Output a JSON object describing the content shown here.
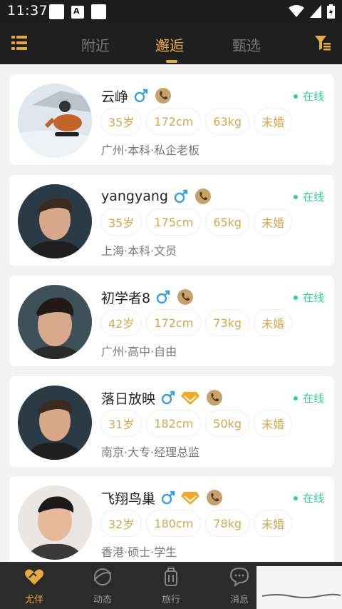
{
  "status_bar": {
    "time": "11:37"
  },
  "header": {
    "tabs": [
      {
        "label": "附近"
      },
      {
        "label": "邂逅"
      },
      {
        "label": "甄选"
      }
    ]
  },
  "users": [
    {
      "name": "云峥",
      "age": "35岁",
      "height": "172cm",
      "weight": "63kg",
      "marital": "未婚",
      "info": "广州·本科·私企老板",
      "status": "在线",
      "vip": false
    },
    {
      "name": "yangyang",
      "age": "35岁",
      "height": "175cm",
      "weight": "65kg",
      "marital": "未婚",
      "info": "上海·本科·文员",
      "status": "在线",
      "vip": false
    },
    {
      "name": "初学者8",
      "age": "42岁",
      "height": "172cm",
      "weight": "73kg",
      "marital": "未婚",
      "info": "广州·高中·自由",
      "status": "在线",
      "vip": false
    },
    {
      "name": "落日放映",
      "age": "31岁",
      "height": "182cm",
      "weight": "50kg",
      "marital": "未婚",
      "info": "南京·大专·经理总监",
      "status": "在线",
      "vip": true
    },
    {
      "name": "飞翔鸟巢",
      "age": "32岁",
      "height": "180cm",
      "weight": "78kg",
      "marital": "未婚",
      "info": "香港·硕士·学生",
      "status": "在线",
      "vip": true
    }
  ],
  "bottom_nav": [
    {
      "label": "尤伴",
      "icon": "heart-hand-icon",
      "active": true
    },
    {
      "label": "动态",
      "icon": "planet-icon",
      "active": false
    },
    {
      "label": "旅行",
      "icon": "luggage-icon",
      "active": false
    },
    {
      "label": "消息",
      "icon": "chat-bubble-icon",
      "active": false
    }
  ],
  "colors": {
    "accent": "#e8ac3e",
    "online": "#2fcf9e",
    "tag_text": "#d6a64c",
    "male": "#3aa0e6"
  }
}
